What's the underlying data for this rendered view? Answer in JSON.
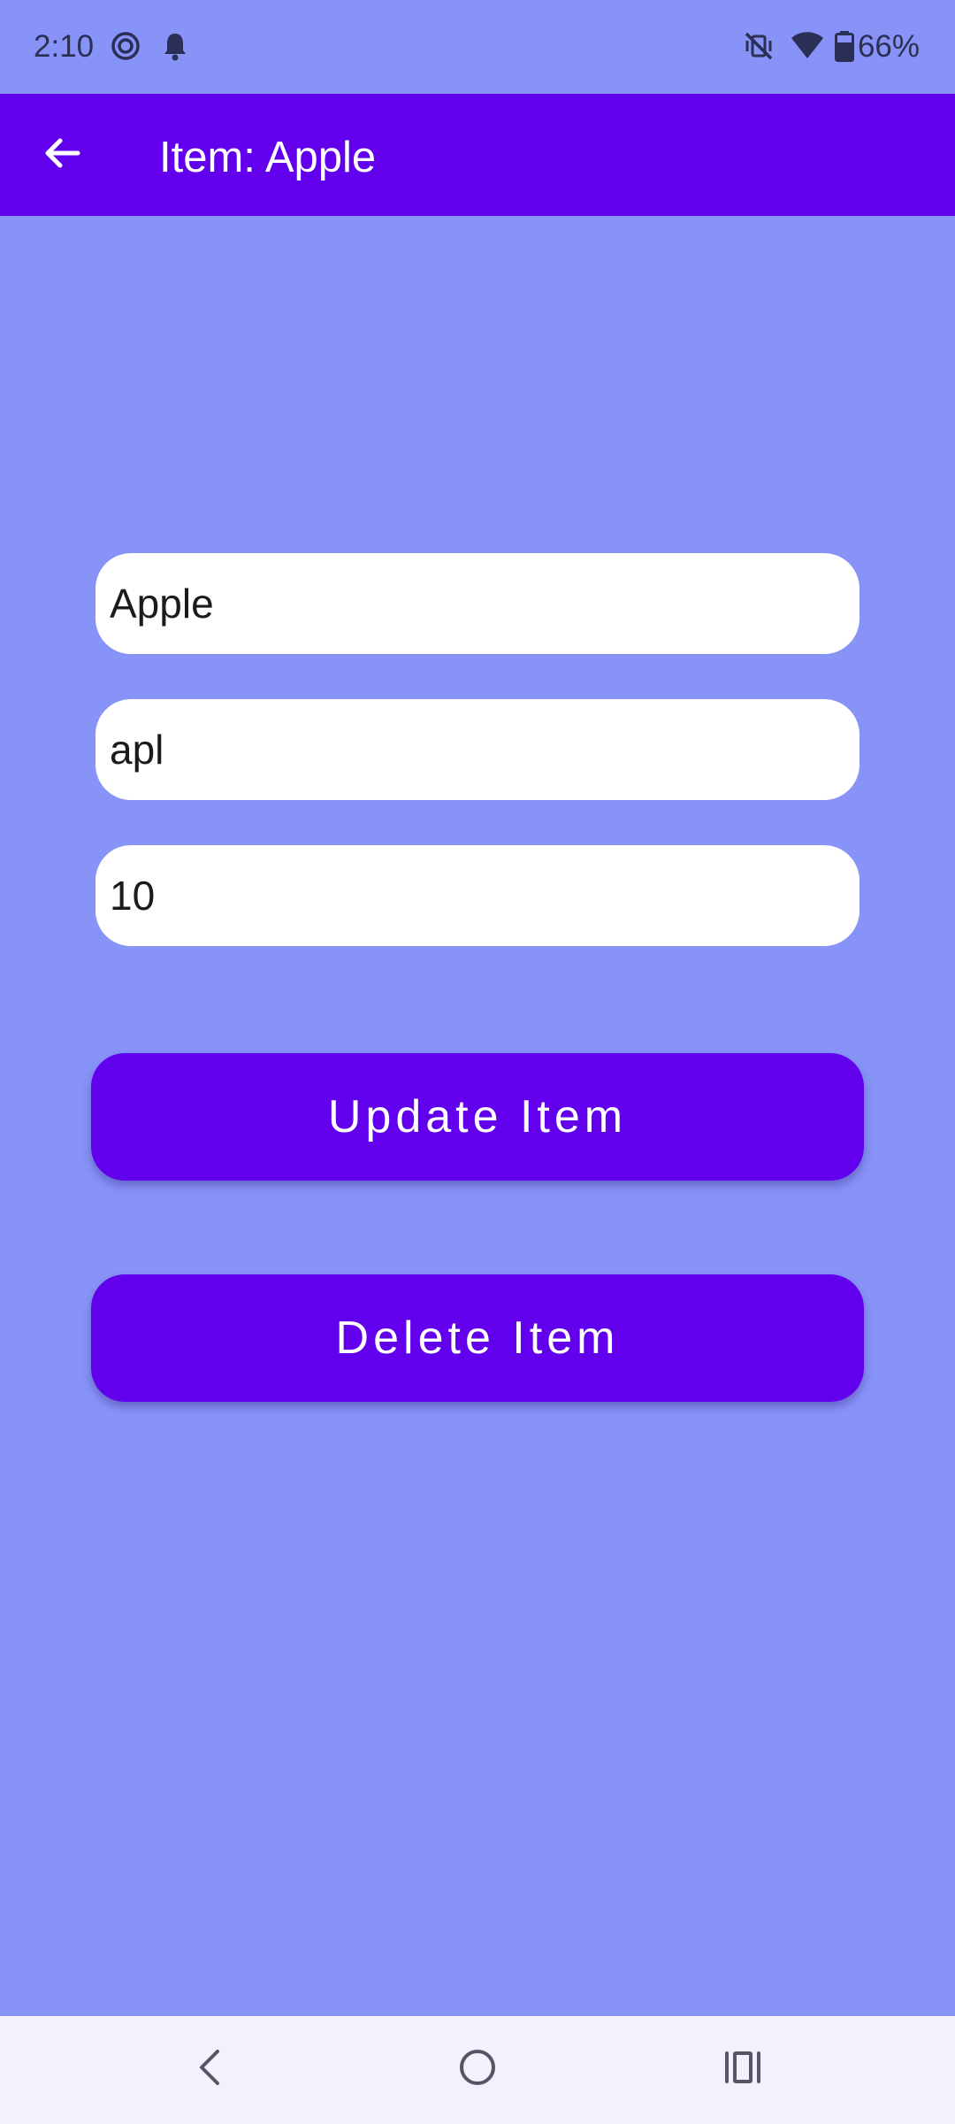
{
  "status_bar": {
    "time": "2:10",
    "battery_text": "66%",
    "icons": [
      "focus-mode-icon",
      "notification-bell-icon",
      "vibrate-silent-icon",
      "wifi-icon",
      "battery-icon"
    ]
  },
  "app_bar": {
    "title": "Item: Apple",
    "back_icon": "arrow-back-icon"
  },
  "form": {
    "name_value": "Apple",
    "code_value": "apl",
    "quantity_value": "10"
  },
  "actions": {
    "update_label": "Update Item",
    "delete_label": "Delete Item"
  },
  "nav_bar": {
    "icons": [
      "nav-back-icon",
      "nav-home-icon",
      "nav-recents-icon"
    ]
  },
  "colors": {
    "background": "#8893f7",
    "primary": "#6200ee",
    "field_background": "#ffffff",
    "nav_bar_background": "#f1f2fd"
  }
}
